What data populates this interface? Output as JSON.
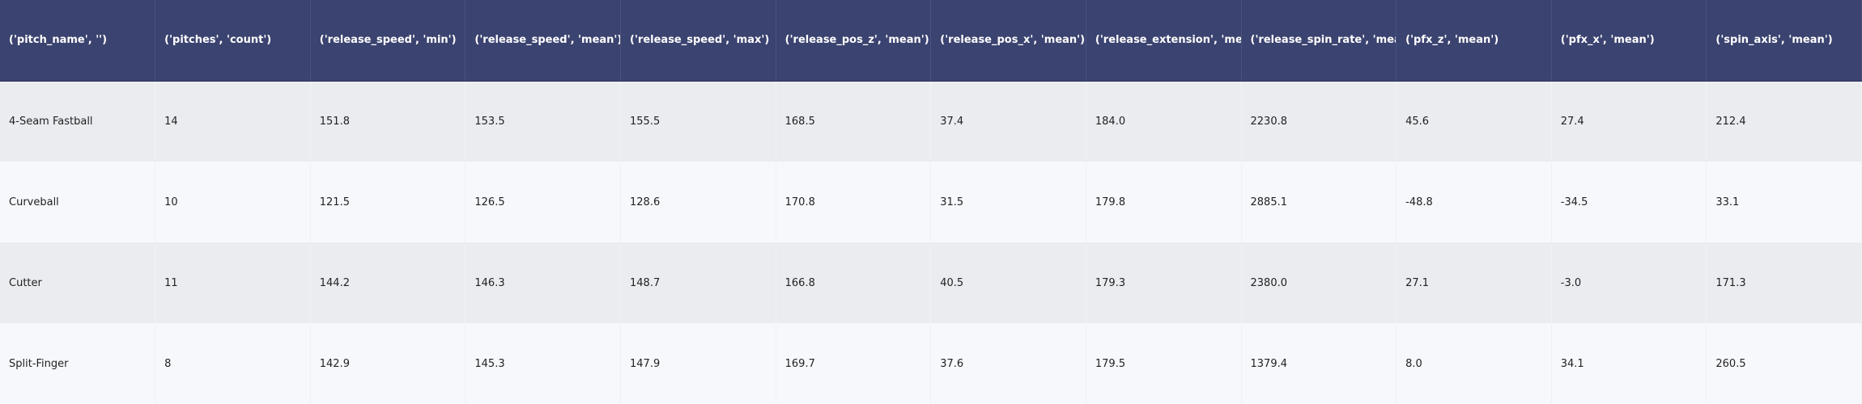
{
  "table": {
    "columns": [
      "('pitch_name', '')",
      "('pitches', 'count')",
      "('release_speed', 'min')",
      "('release_speed', 'mean')",
      "('release_speed', 'max')",
      "('release_pos_z', 'mean')",
      "('release_pos_x', 'mean')",
      "('release_extension', 'mean')",
      "('release_spin_rate', 'mean')",
      "('pfx_z', 'mean')",
      "('pfx_x', 'mean')",
      "('spin_axis', 'mean')"
    ],
    "rows": [
      [
        "4-Seam Fastball",
        "14",
        "151.8",
        "153.5",
        "155.5",
        "168.5",
        "37.4",
        "184.0",
        "2230.8",
        "45.6",
        "27.4",
        "212.4"
      ],
      [
        "Curveball",
        "10",
        "121.5",
        "126.5",
        "128.6",
        "170.8",
        "31.5",
        "179.8",
        "2885.1",
        "-48.8",
        "-34.5",
        "33.1"
      ],
      [
        "Cutter",
        "11",
        "144.2",
        "146.3",
        "148.7",
        "166.8",
        "40.5",
        "179.3",
        "2380.0",
        "27.1",
        "-3.0",
        "171.3"
      ],
      [
        "Split-Finger",
        "8",
        "142.9",
        "145.3",
        "147.9",
        "169.7",
        "37.6",
        "179.5",
        "1379.4",
        "8.0",
        "34.1",
        "260.5"
      ]
    ]
  },
  "colors": {
    "header_bg": "#3b4370",
    "header_text": "#ffffff",
    "row_odd_bg": "#ebecf0",
    "row_even_bg": "#f7f8fc"
  }
}
